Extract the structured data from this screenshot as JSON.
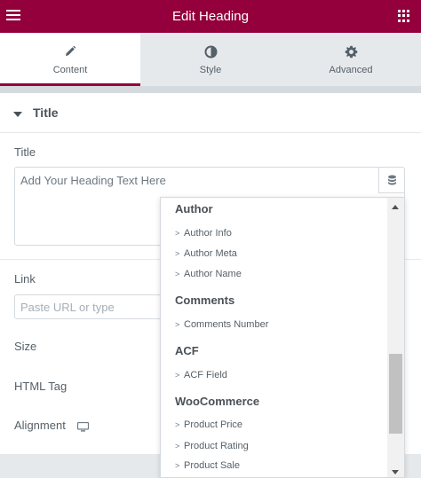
{
  "header": {
    "title": "Edit Heading",
    "menu_icon": "hamburger-icon",
    "apps_icon": "grid-icon",
    "brand_color": "#93003c"
  },
  "tabs": [
    {
      "label": "Content",
      "icon": "pencil-icon",
      "active": true
    },
    {
      "label": "Style",
      "icon": "half-circle-icon",
      "active": false
    },
    {
      "label": "Advanced",
      "icon": "gear-icon",
      "active": false
    }
  ],
  "section": {
    "title": "Title",
    "expanded": true
  },
  "controls": {
    "title_label": "Title",
    "title_placeholder": "Add Your Heading Text Here",
    "link_label": "Link",
    "link_placeholder": "Paste URL or type",
    "size_label": "Size",
    "html_tag_label": "HTML Tag",
    "alignment_label": "Alignment"
  },
  "dynamic_tags": {
    "groups": [
      {
        "name": "Author",
        "items": [
          "Author Info",
          "Author Meta",
          "Author Name"
        ]
      },
      {
        "name": "Comments",
        "items": [
          "Comments Number"
        ]
      },
      {
        "name": "ACF",
        "items": [
          "ACF Field"
        ]
      },
      {
        "name": "WooCommerce",
        "items": [
          "Product Price",
          "Product Rating",
          "Product Sale"
        ]
      }
    ],
    "chevron": ">"
  }
}
